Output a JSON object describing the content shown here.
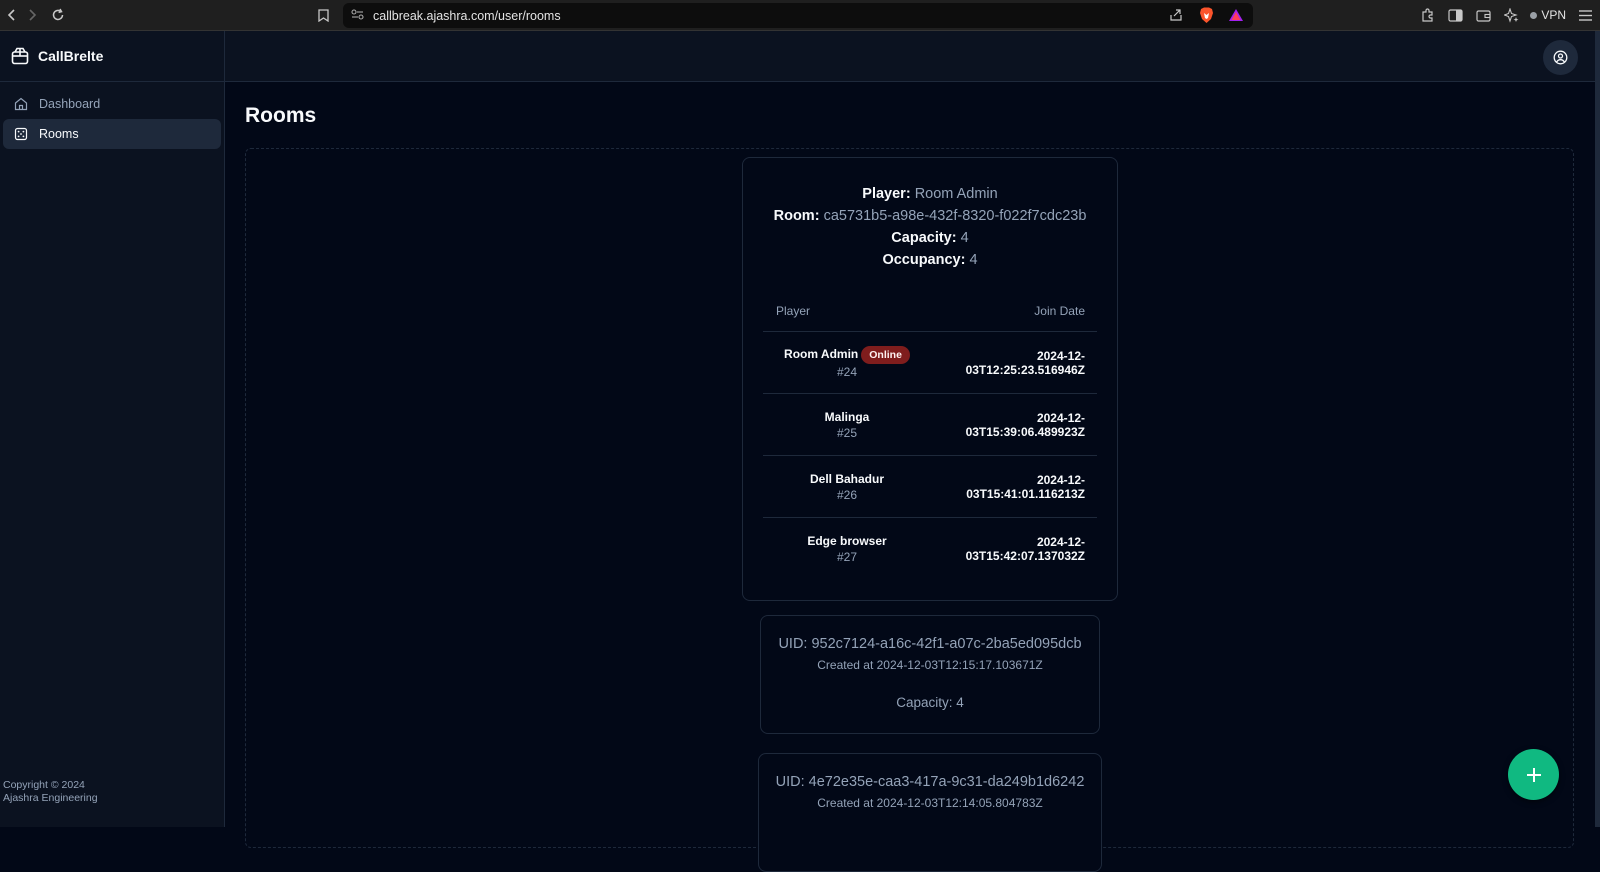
{
  "browser": {
    "url": "callbreak.ajashra.com/user/rooms",
    "vpn_label": "VPN"
  },
  "app": {
    "brand": "CallBrelte",
    "copyright_line1": "Copyright © 2024",
    "copyright_line2": "Ajashra Engineering"
  },
  "sidebar": {
    "items": [
      {
        "label": "Dashboard",
        "icon": "home-icon",
        "active": false
      },
      {
        "label": "Rooms",
        "icon": "dice-icon",
        "active": true
      }
    ]
  },
  "page": {
    "title": "Rooms"
  },
  "current_room": {
    "player_label": "Player:",
    "player_value": "Room Admin",
    "room_label": "Room:",
    "room_value": "ca5731b5-a98e-432f-8320-f022f7cdc23b",
    "capacity_label": "Capacity:",
    "capacity_value": "4",
    "occupancy_label": "Occupancy:",
    "occupancy_value": "4",
    "table": {
      "col_player": "Player",
      "col_join": "Join Date",
      "rows": [
        {
          "name": "Room Admin",
          "id": "#24",
          "badge": "Online",
          "join": "2024-12-03T12:25:23.516946Z"
        },
        {
          "name": "Malinga",
          "id": "#25",
          "badge": "",
          "join": "2024-12-03T15:39:06.489923Z"
        },
        {
          "name": "Dell Bahadur",
          "id": "#26",
          "badge": "",
          "join": "2024-12-03T15:41:01.116213Z"
        },
        {
          "name": "Edge browser",
          "id": "#27",
          "badge": "",
          "join": "2024-12-03T15:42:07.137032Z"
        }
      ]
    }
  },
  "rooms": [
    {
      "uid": "UID: 952c7124-a16c-42f1-a07c-2ba5ed095dcb",
      "created": "Created at 2024-12-03T12:15:17.103671Z",
      "capacity": "Capacity: 4"
    },
    {
      "uid": "UID: 4e72e35e-caa3-417a-9c31-da249b1d6242",
      "created": "Created at 2024-12-03T12:14:05.804783Z",
      "capacity": ""
    }
  ],
  "colors": {
    "accent": "#10b981",
    "online_badge": "#7f1d1d",
    "background": "#020817"
  }
}
